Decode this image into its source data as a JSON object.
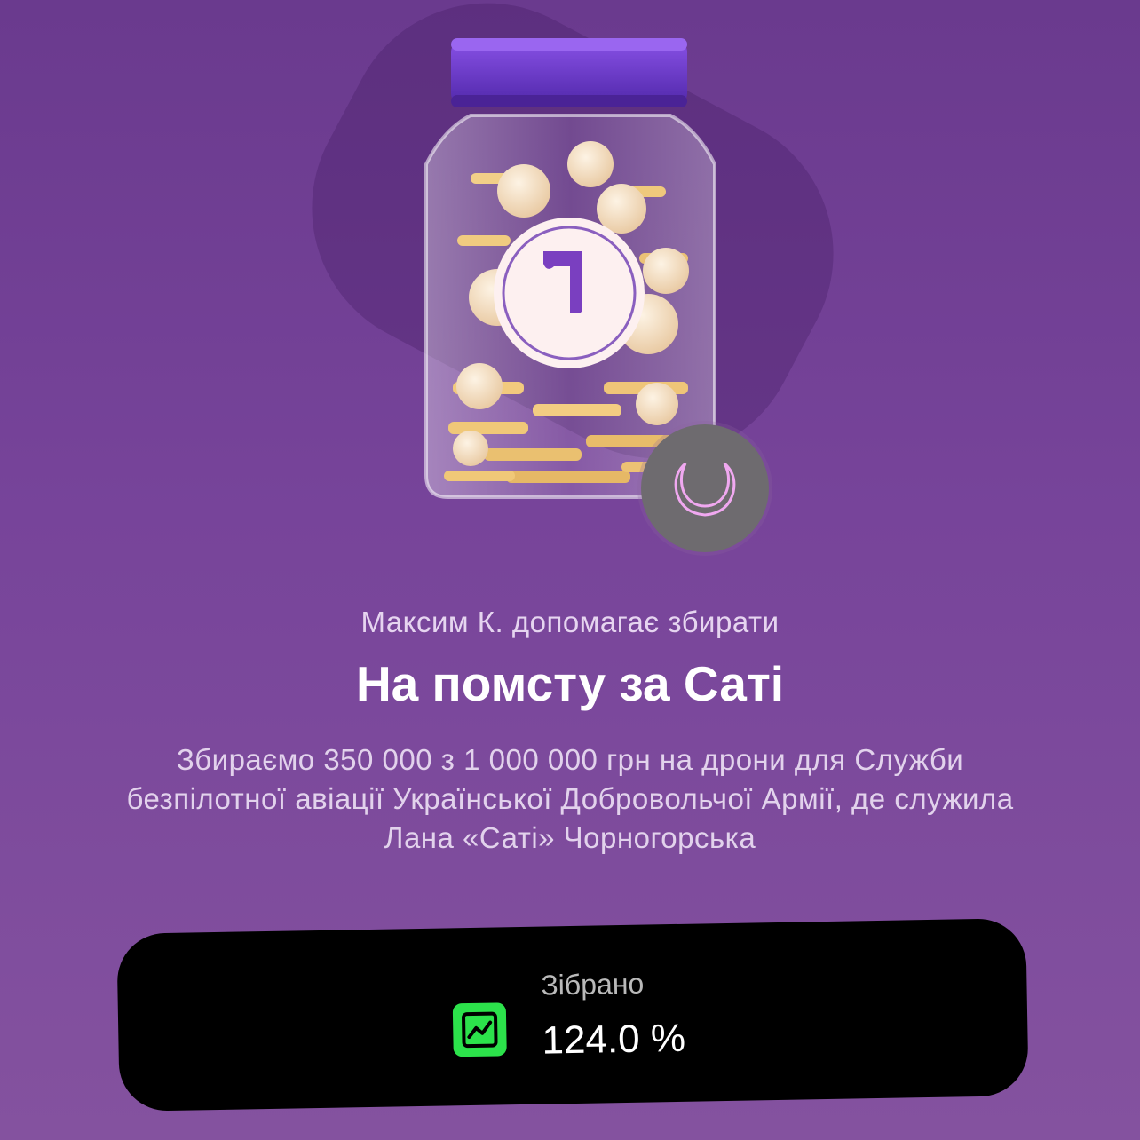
{
  "header": {
    "subtitle": "Максим К. допомагає збирати",
    "title": "На помсту за Саті"
  },
  "description": {
    "text": "Збираємо 350 000 з 1 000 000 грн на дрони для Служби безпілотної авіації Української Добровольчої Армії, де служила Лана «Саті» Чорногорська"
  },
  "stats": {
    "label": "Зібрано",
    "value": "124.0 %",
    "icon": "chart-trend-icon"
  },
  "illustration": {
    "jar_icon": "jar-with-coins-icon",
    "badge_icon": "moon-icon"
  },
  "colors": {
    "background": "#77449a",
    "lid": "#6a36c4",
    "accent_green": "#2ce24b",
    "card": "#000000",
    "moon": "#f0a8f0"
  }
}
